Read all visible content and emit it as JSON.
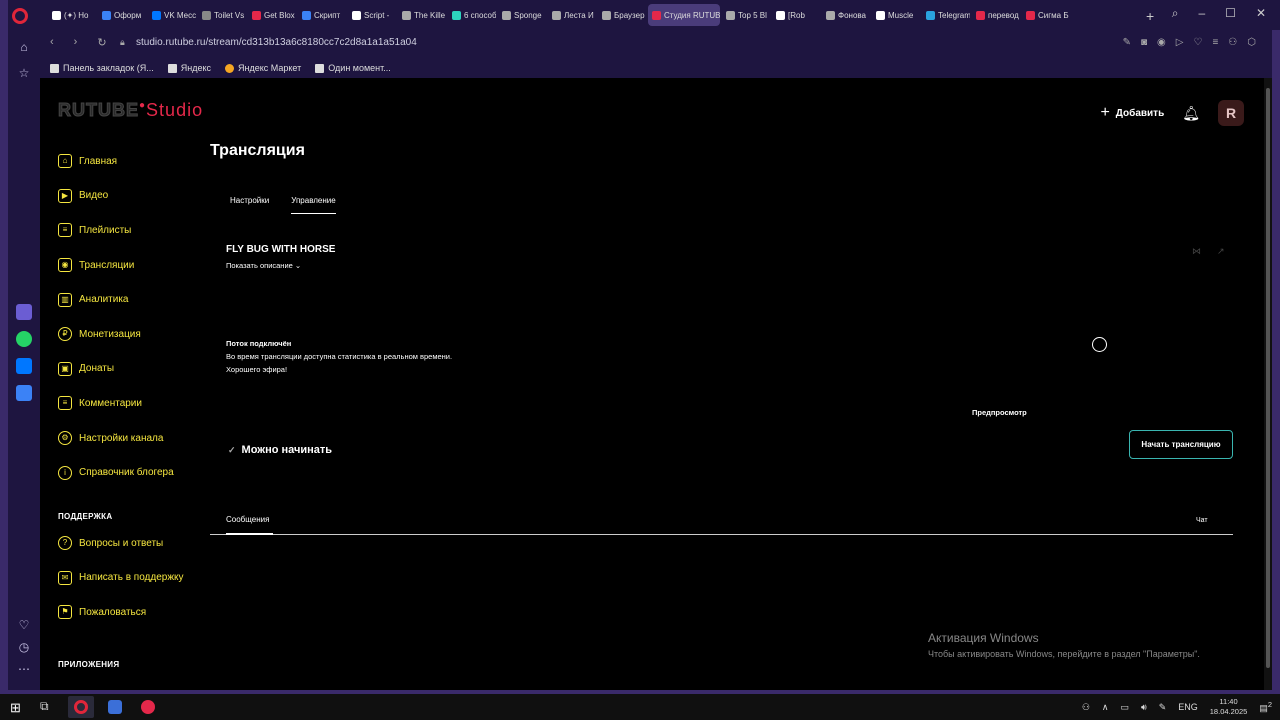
{
  "browser": {
    "tabs": [
      {
        "label": "(✦) Но",
        "color": "#fff"
      },
      {
        "label": "Оформ",
        "color": "#3b82f6"
      },
      {
        "label": "VK Месс",
        "color": "#0077ff"
      },
      {
        "label": "Toilet Vs",
        "color": "#888"
      },
      {
        "label": "Get Blox",
        "color": "#e4284a"
      },
      {
        "label": "Скрипт",
        "color": "#3b82f6"
      },
      {
        "label": "Script -",
        "color": "#fff"
      },
      {
        "label": "The Kille",
        "color": "#aaa"
      },
      {
        "label": "6 способ",
        "color": "#2dd4bf"
      },
      {
        "label": "Sponge",
        "color": "#aaa"
      },
      {
        "label": "Леста И",
        "color": "#aaa"
      },
      {
        "label": "Браузер",
        "color": "#aaa"
      },
      {
        "label": "Студия RUTUB",
        "color": "#e4284a"
      },
      {
        "label": "Top 5 Bl",
        "color": "#aaa"
      },
      {
        "label": "[Rob",
        "color": "#fff"
      },
      {
        "label": "Фонова",
        "color": "#aaa"
      },
      {
        "label": "Muscle",
        "color": "#fff"
      },
      {
        "label": "Telegram",
        "color": "#2aa3df"
      },
      {
        "label": "перевод",
        "color": "#e4284a"
      },
      {
        "label": "Сигма Б",
        "color": "#e4284a"
      }
    ],
    "url": "studio.rutube.ru/stream/cd313b13a6c8180cc7c2d8a1a1a51a04",
    "bookmarks": [
      "Панель закладок (Я...",
      "Яндекс",
      "Яндекс Маркет",
      "Один момент..."
    ]
  },
  "header": {
    "logo_main": "RUTUBE",
    "logo_studio": "Studio",
    "add_label": "Добавить",
    "avatar_letter": "R"
  },
  "nav": {
    "items": [
      {
        "label": "Главная",
        "icon": "home-icon"
      },
      {
        "label": "Видео",
        "icon": "video-icon"
      },
      {
        "label": "Плейлисты",
        "icon": "playlist-icon"
      },
      {
        "label": "Трансляции",
        "icon": "broadcast-icon"
      },
      {
        "label": "Аналитика",
        "icon": "analytics-icon"
      },
      {
        "label": "Монетизация",
        "icon": "ruble-icon"
      },
      {
        "label": "Донаты",
        "icon": "donate-icon"
      },
      {
        "label": "Комментарии",
        "icon": "comment-icon"
      },
      {
        "label": "Настройки канала",
        "icon": "gear-icon"
      },
      {
        "label": "Справочник блогера",
        "icon": "info-icon"
      }
    ],
    "support_label": "ПОДДЕРЖКА",
    "support_items": [
      {
        "label": "Вопросы и ответы",
        "icon": "question-icon"
      },
      {
        "label": "Написать в поддержку",
        "icon": "mail-icon"
      },
      {
        "label": "Пожаловаться",
        "icon": "flag-icon"
      }
    ],
    "apps_label": "ПРИЛОЖЕНИЯ"
  },
  "main": {
    "title": "Трансляция",
    "tabs": [
      "Настройки",
      "Управление"
    ],
    "stream_title": "FLY BUG WITH HORSE",
    "show_description": "Показать описание",
    "status_title": "Поток подключён",
    "status_line1": "Во время трансляции доступна статистика в реальном времени.",
    "status_line2": "Хорошего эфира!",
    "preview_label": "Предпросмотр",
    "ready_label": "Можно начинать",
    "start_button": "Начать трансляцию",
    "messages_tab": "Сообщения",
    "chat_tab": "Чат"
  },
  "watermark": {
    "line1": "Активация Windows",
    "line2": "Чтобы активировать Windows, перейдите в раздел \"Параметры\"."
  },
  "taskbar": {
    "lang": "ENG",
    "time": "11:40",
    "date": "18.04.2025",
    "notifications": "2"
  },
  "colors": {
    "accent_yellow": "#f5e640",
    "brand_red": "#e4284a",
    "button_border": "#3ab5b0"
  }
}
